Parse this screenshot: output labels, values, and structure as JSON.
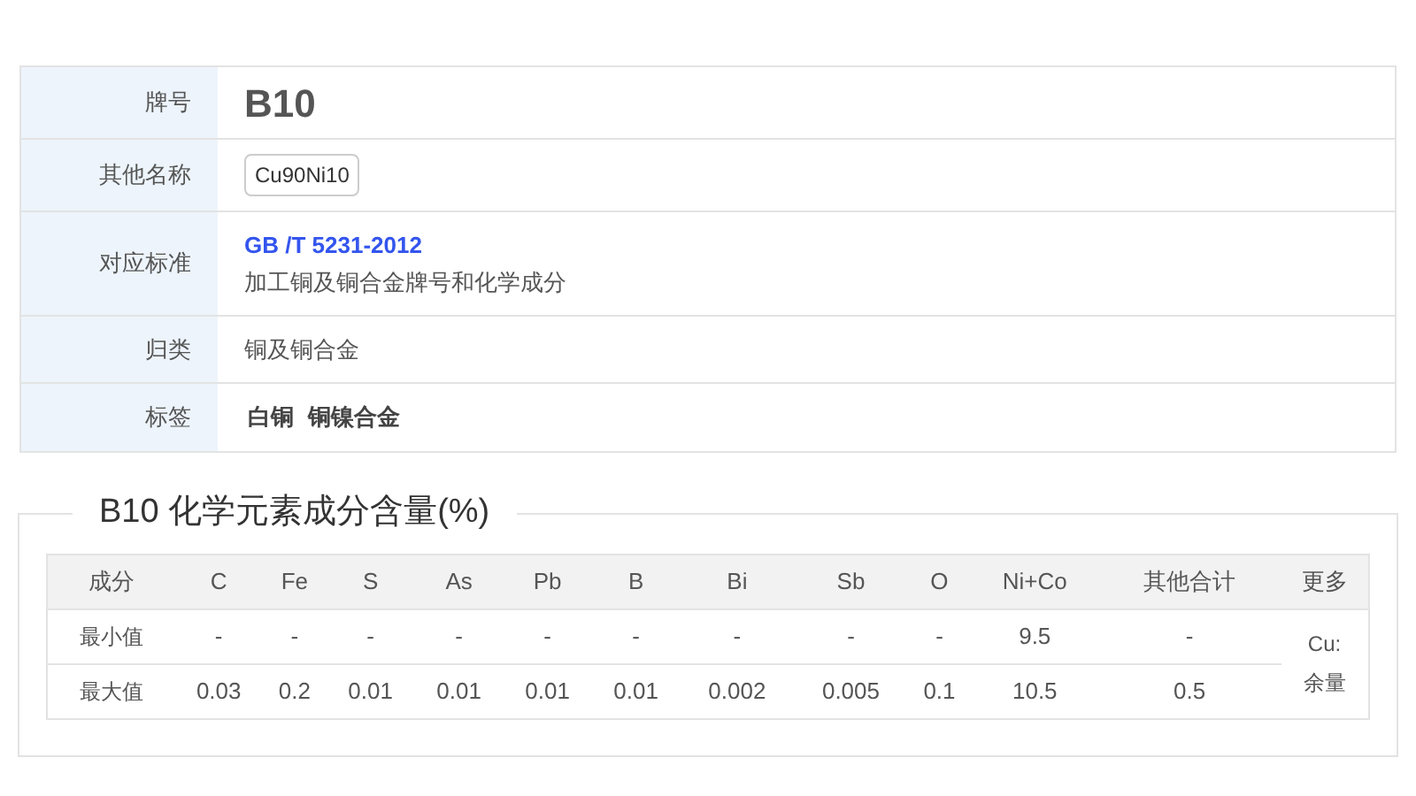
{
  "info": {
    "rows": [
      {
        "label": "牌号",
        "kind": "title",
        "value": "B10"
      },
      {
        "label": "其他名称",
        "kind": "tags",
        "values": [
          "Cu90Ni10"
        ]
      },
      {
        "label": "对应标准",
        "kind": "standard",
        "link": "GB /T 5231-2012",
        "value": "加工铜及铜合金牌号和化学成分"
      },
      {
        "label": "归类",
        "kind": "text",
        "value": "铜及铜合金"
      },
      {
        "label": "标签",
        "kind": "bold",
        "values": [
          "白铜",
          "铜镍合金"
        ]
      }
    ]
  },
  "composition": {
    "title": "B10 化学元素成分含量(%)",
    "row_header": "成分",
    "columns": [
      "C",
      "Fe",
      "S",
      "As",
      "Pb",
      "B",
      "Bi",
      "Sb",
      "O",
      "Ni+Co",
      "其他合计",
      "更多"
    ],
    "rows": [
      {
        "label": "最小值",
        "cells": [
          "-",
          "-",
          "-",
          "-",
          "-",
          "-",
          "-",
          "-",
          "-",
          "9.5",
          "-"
        ]
      },
      {
        "label": "最大值",
        "cells": [
          "0.03",
          "0.2",
          "0.01",
          "0.01",
          "0.01",
          "0.01",
          "0.002",
          "0.005",
          "0.1",
          "10.5",
          "0.5"
        ]
      }
    ],
    "more": "Cu: 余量"
  }
}
